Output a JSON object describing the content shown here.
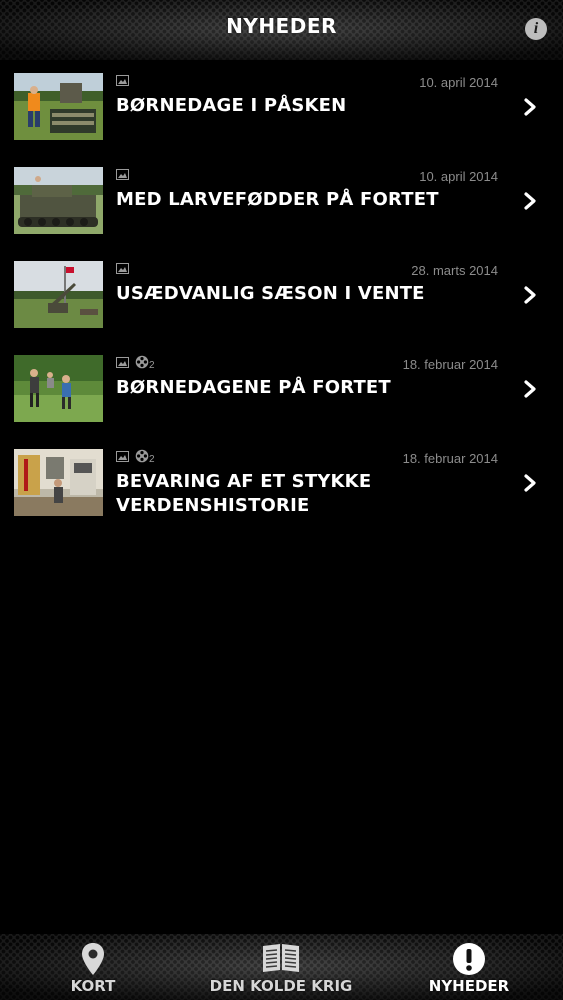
{
  "header": {
    "title": "NYHEDER",
    "info_label": "i"
  },
  "news": [
    {
      "date": "10. april 2014",
      "title": "BØRNEDAGE I PÅSKEN",
      "has_image": true,
      "has_video": false,
      "video_count": ""
    },
    {
      "date": "10. april 2014",
      "title": "MED LARVEFØDDER PÅ FORTET",
      "has_image": true,
      "has_video": false,
      "video_count": ""
    },
    {
      "date": "28. marts 2014",
      "title": "USÆDVANLIG SÆSON I VENTE",
      "has_image": true,
      "has_video": false,
      "video_count": ""
    },
    {
      "date": "18. februar 2014",
      "title": "BØRNEDAGENE PÅ FORTET",
      "has_image": true,
      "has_video": true,
      "video_count": "2"
    },
    {
      "date": "18. februar 2014",
      "title": "BEVARING AF ET STYKKE VERDENSHISTORIE",
      "has_image": true,
      "has_video": true,
      "video_count": "2"
    }
  ],
  "tabs": [
    {
      "label": "KORT",
      "icon": "map-pin-icon",
      "active": false
    },
    {
      "label": "DEN KOLDE KRIG",
      "icon": "book-icon",
      "active": false
    },
    {
      "label": "NYHEDER",
      "icon": "exclamation-icon",
      "active": true
    }
  ],
  "colors": {
    "background": "#000000",
    "date_text": "#8c8c8c",
    "title_text": "#ffffff"
  }
}
